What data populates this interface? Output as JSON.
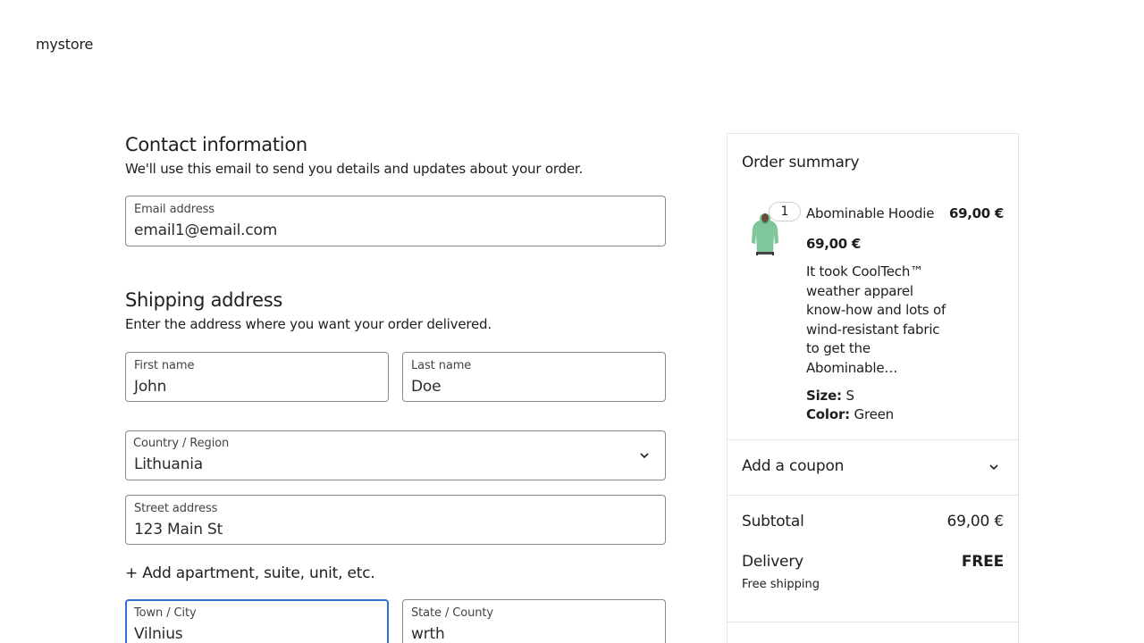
{
  "site": {
    "title": "mystore"
  },
  "contact": {
    "title": "Contact information",
    "description": "We'll use this email to send you details and updates about your order.",
    "email": {
      "label": "Email address",
      "value": "email1@email.com"
    }
  },
  "shipping": {
    "title": "Shipping address",
    "description": "Enter the address where you want your order delivered.",
    "first_name": {
      "label": "First name",
      "value": "John"
    },
    "last_name": {
      "label": "Last name",
      "value": "Doe"
    },
    "country": {
      "label": "Country / Region",
      "value": "Lithuania"
    },
    "street": {
      "label": "Street address",
      "value": "123 Main St"
    },
    "add_apartment": "+ Add apartment, suite, unit, etc.",
    "city": {
      "label": "Town / City",
      "value": "Vilnius"
    },
    "state": {
      "label": "State / County",
      "value": "wrth"
    }
  },
  "summary": {
    "title": "Order summary",
    "item": {
      "quantity": "1",
      "name": "Abominable Hoodie",
      "line_total": "69,00 €",
      "price": "69,00 €",
      "description": "It took CoolTech™ weather apparel know-how and lots of wind-resistant fabric to get the Abominable…",
      "size_label": "Size:",
      "size_value": "S",
      "color_label": "Color:",
      "color_value": "Green",
      "thumbnail_icon": "hoodie-thumbnail"
    },
    "coupon_label": "Add a coupon",
    "subtotal_label": "Subtotal",
    "subtotal_value": "69,00 €",
    "delivery_label": "Delivery",
    "delivery_value": "FREE",
    "delivery_note": "Free shipping"
  },
  "colors": {
    "focus": "#2e6fd8",
    "border": "#8a8a8a",
    "text": "#1e1e1e"
  }
}
